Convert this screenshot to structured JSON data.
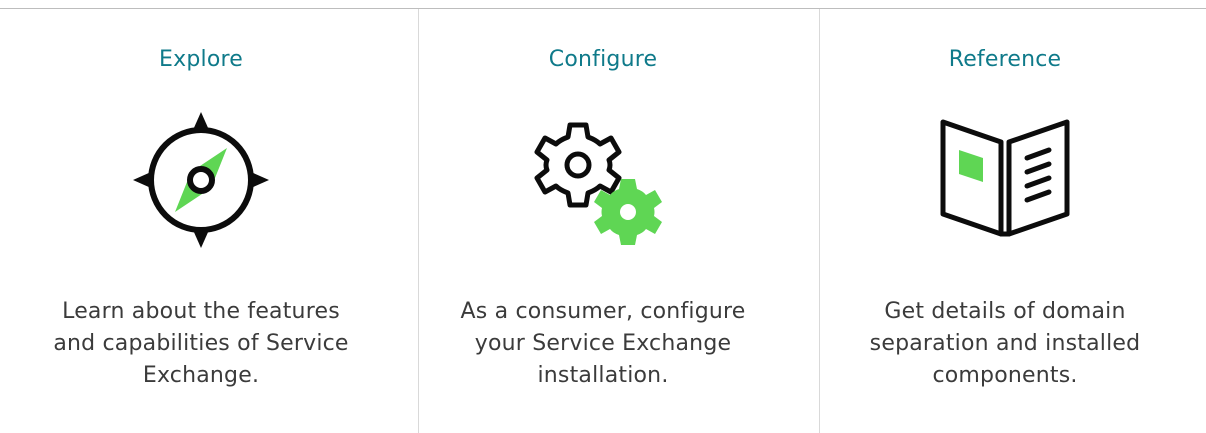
{
  "colors": {
    "title": "#0f7a8a",
    "text": "#3b3b3b",
    "accent": "#5fd654",
    "icon_stroke": "#0c0c0c",
    "rule": "#bdbdbd"
  },
  "cards": [
    {
      "title": "Explore",
      "icon": "compass-icon",
      "description": "Learn about the features and capabilities of Service Exchange."
    },
    {
      "title": "Configure",
      "icon": "gears-icon",
      "description": "As a consumer, configure your Service Exchange installation."
    },
    {
      "title": "Reference",
      "icon": "book-icon",
      "description": "Get details of domain separation and installed components."
    }
  ]
}
